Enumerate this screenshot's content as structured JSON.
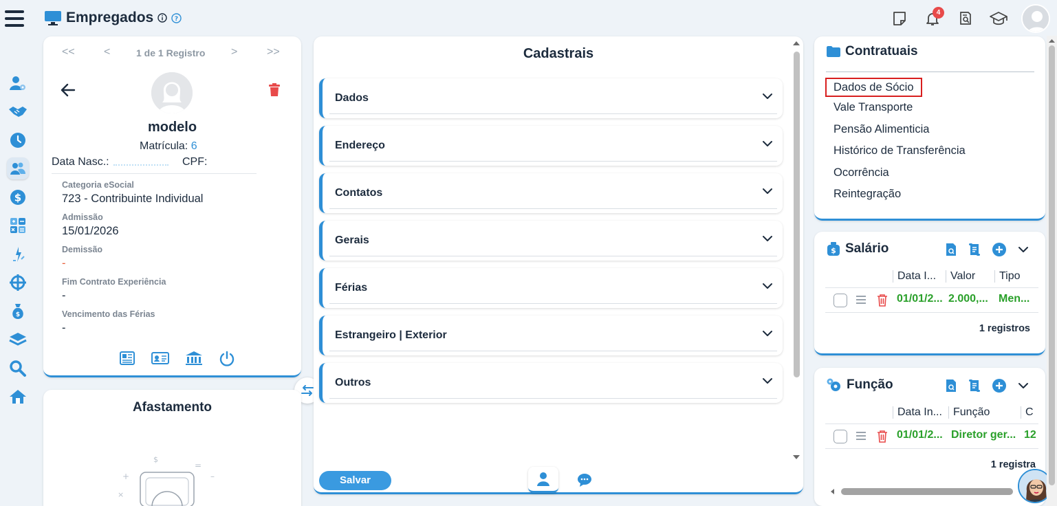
{
  "header": {
    "title": "Empregados",
    "notifications_count": "4"
  },
  "nav": {
    "items": [
      {
        "icon": "user-gear-icon"
      },
      {
        "icon": "handshake-icon"
      },
      {
        "icon": "clock-icon"
      },
      {
        "icon": "users-icon",
        "active": true
      },
      {
        "icon": "dollar-icon"
      },
      {
        "icon": "calculator-icon"
      },
      {
        "icon": "pencil-chart-icon"
      },
      {
        "icon": "globe-network-icon"
      },
      {
        "icon": "money-bag-icon"
      },
      {
        "icon": "layers-icon"
      },
      {
        "icon": "search-icon"
      },
      {
        "icon": "home-icon"
      }
    ]
  },
  "employee": {
    "pager_first": "<<",
    "pager_prev": "<",
    "pager_text": "1 de 1 Registro",
    "pager_next": ">",
    "pager_last": ">>",
    "name": "modelo",
    "matricula_label": "Matrícula:",
    "matricula_value": "6",
    "data_nasc_label": "Data Nasc.:",
    "cpf_label": "CPF:",
    "fields": [
      {
        "label": "Categoria eSocial",
        "value": "723 - Contribuinte Individual"
      },
      {
        "label": "Admissão",
        "value": "15/01/2026"
      },
      {
        "label": "Demissão",
        "value": "-"
      },
      {
        "label": "Fim Contrato Experiência",
        "value": "-"
      },
      {
        "label": "Vencimento das Férias",
        "value": "-"
      }
    ]
  },
  "afastamento": {
    "title": "Afastamento"
  },
  "cadastrais": {
    "title": "Cadastrais",
    "sections": [
      "Dados",
      "Endereço",
      "Contatos",
      "Gerais",
      "Férias",
      "Estrangeiro | Exterior",
      "Outros"
    ],
    "save_label": "Salvar"
  },
  "contratuais": {
    "title": "Contratuais",
    "items": [
      "Dados de Sócio",
      "Vale Transporte",
      "Pensão Alimenticia",
      "Histórico de Transferência",
      "Ocorrência",
      "Reintegração"
    ]
  },
  "salario": {
    "title": "Salário",
    "columns": [
      "Data I...",
      "Valor",
      "Tipo"
    ],
    "row": [
      "01/01/2...",
      "2.000,...",
      "Men..."
    ],
    "count": "1 registros"
  },
  "funcao": {
    "title": "Função",
    "columns": [
      "Data In...",
      "Função",
      "C"
    ],
    "row": [
      "01/01/2...",
      "Diretor ger...",
      "12"
    ],
    "count": "1 registra"
  },
  "colors": {
    "accent": "#2e8fd6",
    "danger": "#e84a4a",
    "success": "#2aa02a"
  }
}
